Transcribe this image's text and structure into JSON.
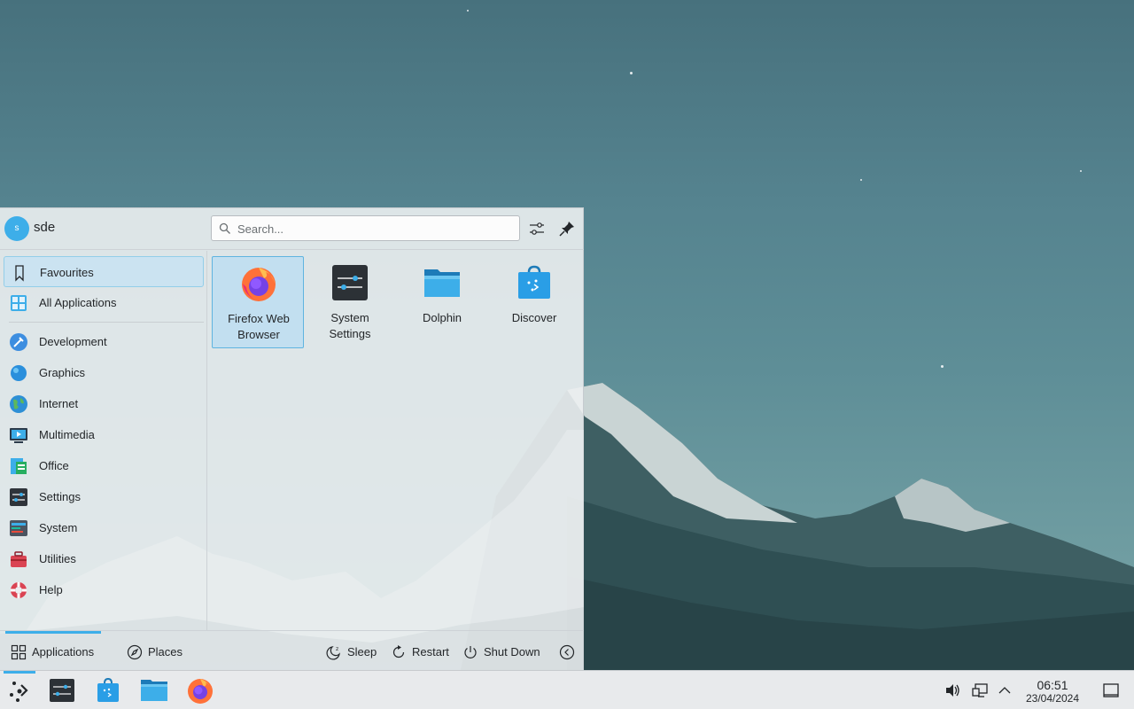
{
  "launcher": {
    "user": {
      "initial": "s",
      "name": "sde"
    },
    "search": {
      "placeholder": "Search..."
    },
    "header_icons": [
      "configure-icon",
      "pin-icon"
    ],
    "sidebar": [
      {
        "label": "Favourites",
        "icon": "bookmark-icon",
        "active": true
      },
      {
        "label": "All Applications",
        "icon": "grid-icon"
      },
      {
        "label": "Development",
        "icon": "development-icon"
      },
      {
        "label": "Graphics",
        "icon": "graphics-icon"
      },
      {
        "label": "Internet",
        "icon": "globe-icon"
      },
      {
        "label": "Multimedia",
        "icon": "multimedia-icon"
      },
      {
        "label": "Office",
        "icon": "office-icon"
      },
      {
        "label": "Settings",
        "icon": "settings-icon"
      },
      {
        "label": "System",
        "icon": "system-icon"
      },
      {
        "label": "Utilities",
        "icon": "toolbox-icon"
      },
      {
        "label": "Help",
        "icon": "lifebuoy-icon"
      }
    ],
    "favourites": [
      {
        "label_line1": "Firefox Web",
        "label_line2": "Browser",
        "icon": "firefox-icon",
        "active": true
      },
      {
        "label_line1": "System",
        "label_line2": "Settings",
        "icon": "system-settings-icon"
      },
      {
        "label_line1": "Dolphin",
        "label_line2": "",
        "icon": "dolphin-folder-icon"
      },
      {
        "label_line1": "Discover",
        "label_line2": "",
        "icon": "discover-icon"
      }
    ],
    "footer": {
      "applications": "Applications",
      "places": "Places",
      "sleep": "Sleep",
      "restart": "Restart",
      "shutdown": "Shut Down"
    }
  },
  "taskbar": {
    "apps": [
      "application-launcher-icon",
      "system-settings-icon",
      "discover-icon",
      "dolphin-folder-icon",
      "firefox-icon"
    ],
    "tray": [
      "volume-icon",
      "network-icon",
      "chevron-up-icon"
    ],
    "clock": {
      "time": "06:51",
      "date": "23/04/2024"
    },
    "show_desktop": "show-desktop-icon"
  },
  "colors": {
    "accent": "#3daee9",
    "selection": "#cbe3f1",
    "panel": "#e8eaec"
  }
}
